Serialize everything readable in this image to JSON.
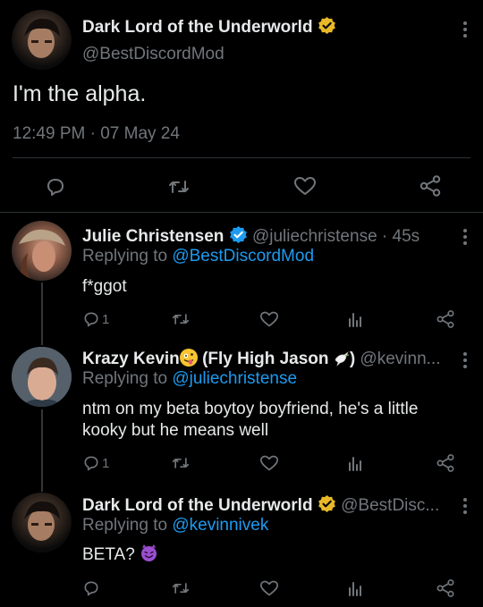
{
  "main_tweet": {
    "author_name": "Dark Lord of the Underworld",
    "handle": "@BestDiscordMod",
    "text": "I'm the alpha.",
    "timestamp": "12:49 PM · 07 May 24"
  },
  "replies": [
    {
      "author_name": "Julie Christensen",
      "handle_time": "@juliechristense · 45s",
      "replying_to_label": "Replying to",
      "replying_to": "@BestDiscordMod",
      "text": "f*ggot",
      "reply_count": "1"
    },
    {
      "author_name": "Krazy Kevin",
      "author_name_suffix": "(Fly High Jason",
      "author_name_close": ")",
      "handle": "@kevinn...",
      "replying_to_label": "Replying to",
      "replying_to": "@juliechristense",
      "text": "ntm on my beta boytoy boyfriend, he's a little kooky but he means well",
      "reply_count": "1"
    },
    {
      "author_name": "Dark Lord of the Underworld",
      "handle": "@BestDisc...",
      "replying_to_label": "Replying to",
      "replying_to": "@kevinnivek",
      "text": "BETA?"
    }
  ],
  "colors": {
    "background": "#000000",
    "text": "#e7e9ea",
    "muted": "#71767b",
    "link": "#1d9bf0",
    "gold_badge": "#e8b828",
    "blue_badge": "#1d9bf0"
  }
}
